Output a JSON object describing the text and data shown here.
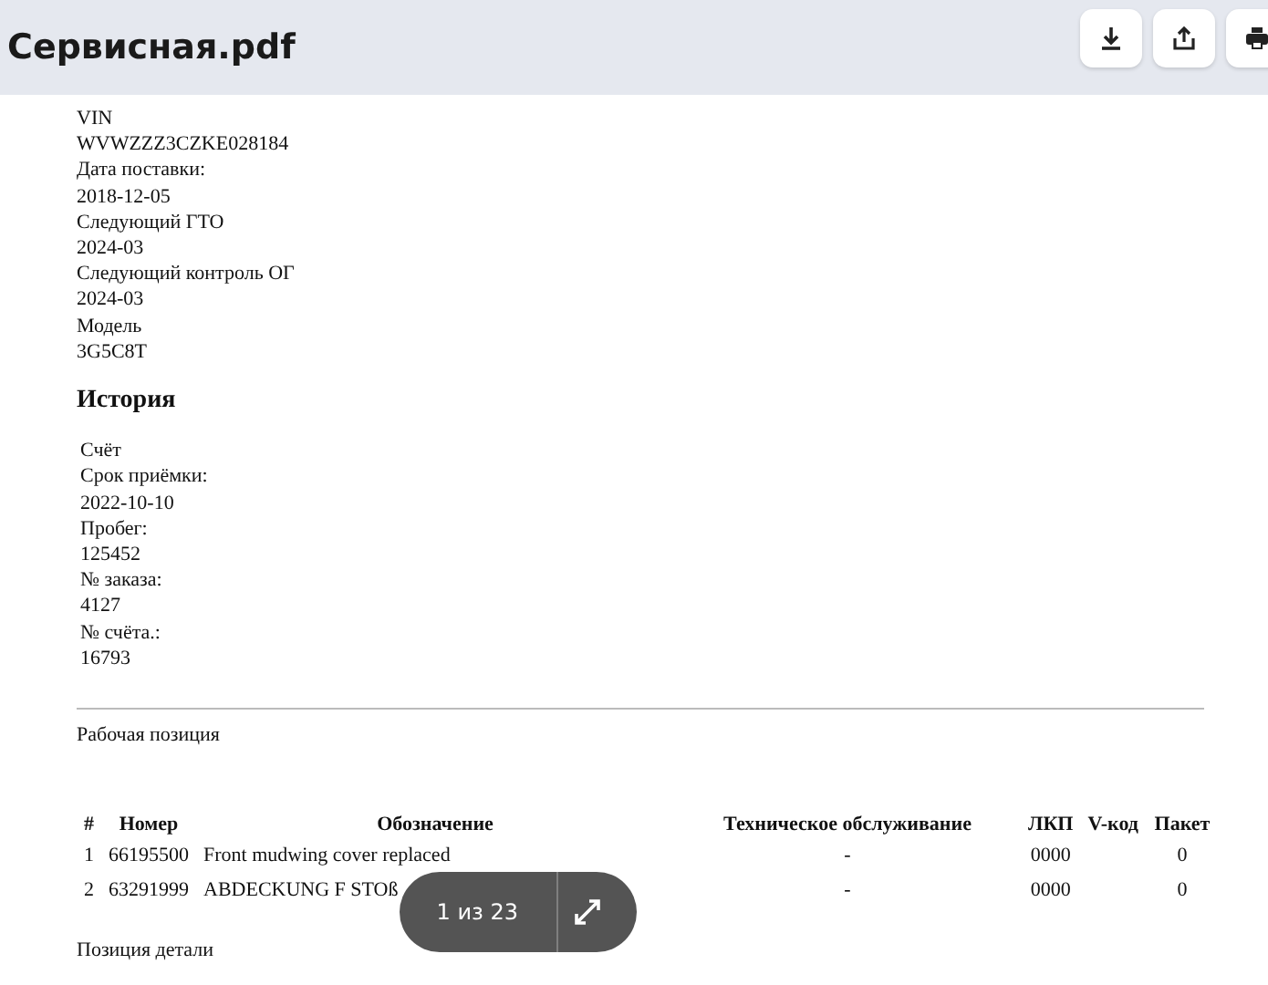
{
  "header": {
    "title": "Сервисная.pdf",
    "buttons": [
      {
        "kind": "download"
      },
      {
        "kind": "share"
      },
      {
        "kind": "print"
      }
    ]
  },
  "document": {
    "vehicle_lines": [
      "VIN",
      "WVWZZZ3CZKE028184",
      "Дата поставки:",
      "2018-12-05",
      "Следующий ГТО",
      "2024-03",
      "Следующий контроль ОГ",
      "2024-03",
      "Модель",
      "3G5C8T"
    ],
    "history_heading": "История",
    "history_lines": [
      "Счёт",
      "Срок приёмки:",
      "2022-10-10",
      "Пробег:",
      "125452",
      "№ заказа:",
      "4127",
      "№ счёта.:",
      "16793"
    ],
    "work_heading": "Рабочая позиция",
    "table": {
      "columns": [
        "#",
        "Номер",
        "Обозначение",
        "Техническое обслуживание",
        "ЛКП",
        "V-код",
        "Пакет"
      ],
      "rows": [
        [
          "1",
          "66195500",
          "Front mudwing cover replaced",
          "-",
          "0000",
          "",
          "0"
        ],
        [
          "2",
          "63291999",
          "ABDECKUNG F STOß",
          "-",
          "0000",
          "",
          "0"
        ]
      ]
    },
    "parts_heading": "Позиция детали"
  },
  "viewer_overlay": {
    "page_counter": "1 из 23"
  }
}
